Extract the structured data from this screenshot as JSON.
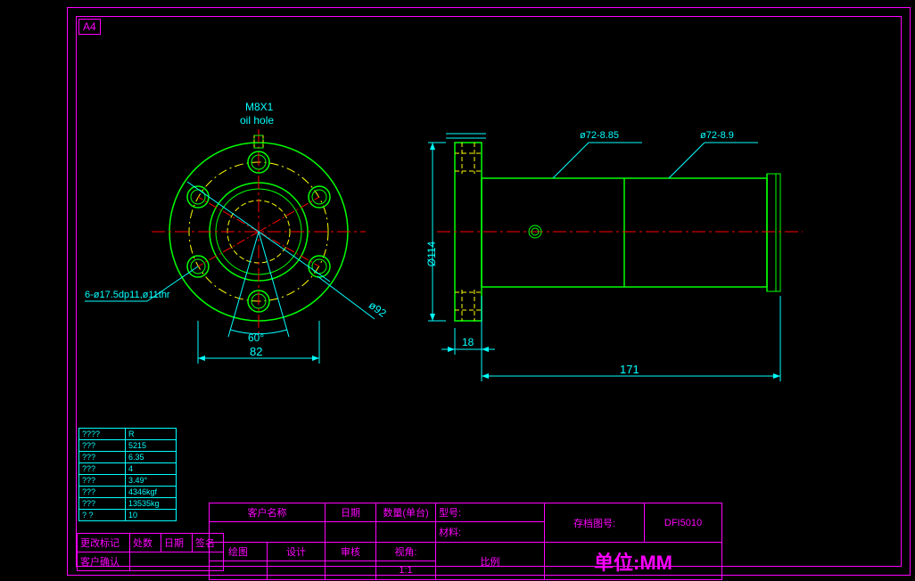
{
  "sheet": {
    "label": "A4"
  },
  "annotations": {
    "thread": "M8X1",
    "oilhole": "oil hole",
    "holespec": "6-ø17.5dp11,ø11thr",
    "angle60": "60°",
    "dim82": "82",
    "diam92": "ø92",
    "diam114": "Ø114",
    "dim18": "18",
    "dim171": "171",
    "diam72a": "ø72-8.85",
    "diam72b": "ø72-8.9"
  },
  "params": {
    "r0c0": "????",
    "r0c1": "R",
    "r1c0": "???",
    "r1c1": "5215",
    "r2c0": "???",
    "r2c1": "6.35",
    "r3c0": "???",
    "r3c1": "4",
    "r4c0": "???",
    "r4c1": "3.49°",
    "r5c0": "???",
    "r5c1": "4346kgf",
    "r6c0": "???",
    "r6c1": "13535kg",
    "r7c0": "? ?",
    "r7c1": "10"
  },
  "titleblock": {
    "changemark": "更改标记",
    "places": "处数",
    "date": "日期",
    "sign": "签名",
    "confirm": "客户确认",
    "customer": "客户名称",
    "datecol": "日期",
    "qty": "数量(单台)",
    "draw": "绘图",
    "design": "设计",
    "review": "审核",
    "viewangle": "视角:",
    "scale": "比例",
    "scaleval": "1:1",
    "model": "型号:",
    "material": "材料:",
    "storageid": "存档图号:",
    "storagecode": "DFI5010",
    "unit": "单位:MM"
  }
}
